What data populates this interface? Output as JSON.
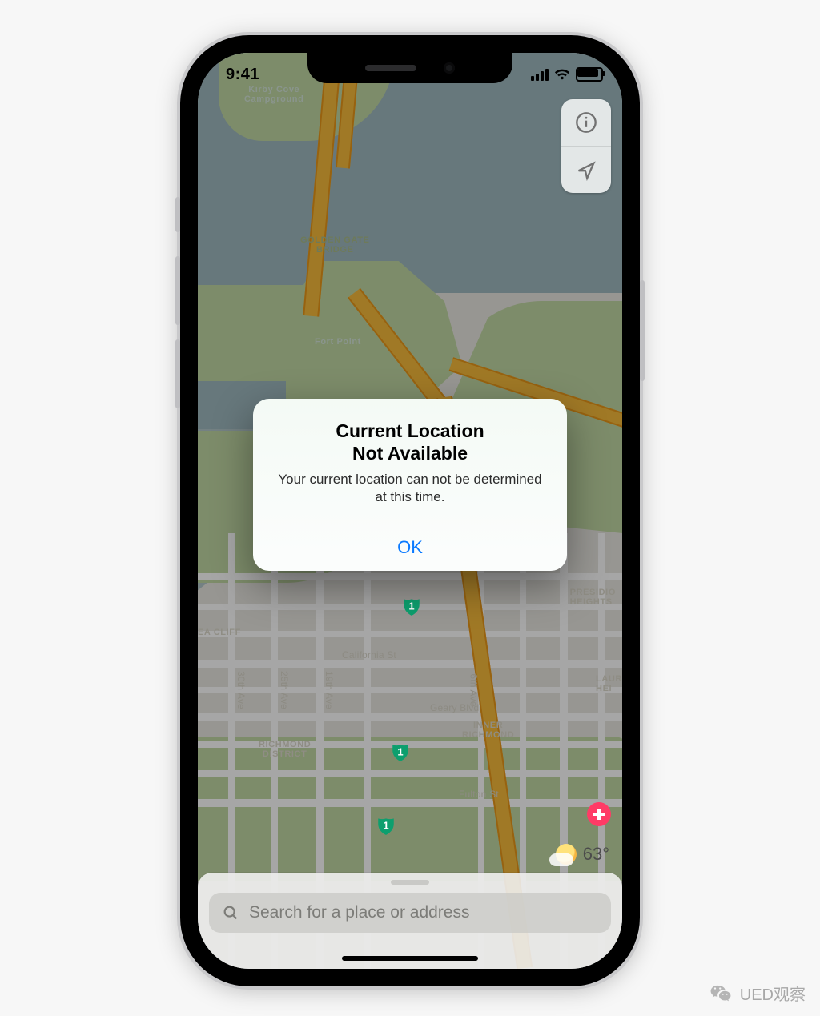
{
  "status_bar": {
    "time": "9:41"
  },
  "map": {
    "labels": {
      "kirby": "Kirby Cove\nCampground",
      "gg": "GOLDEN GATE\nBRIDGE",
      "fortpoint": "Fort Point",
      "presidio": "PRESIDIO\nHEIGHTS",
      "laur": "LAUR\nHEI",
      "inner": "INNER\nRICHMOND",
      "richdist": "RICHMOND\nDISTRICT",
      "seacliff": "EA CLIFF",
      "california": "California St",
      "geary": "Geary Blvd",
      "fulton": "Fulton St",
      "a30": "30th Ave",
      "a25": "25th Ave",
      "a19": "19th Ave",
      "a6": "6th Ave"
    },
    "shield_text": "1",
    "weather_temp": "63°"
  },
  "search": {
    "placeholder": "Search for a place or address"
  },
  "alert": {
    "title_l1": "Current Location",
    "title_l2": "Not Available",
    "message": "Your current location can not be determined at this time.",
    "ok": "OK"
  },
  "watermark": "UED观察"
}
